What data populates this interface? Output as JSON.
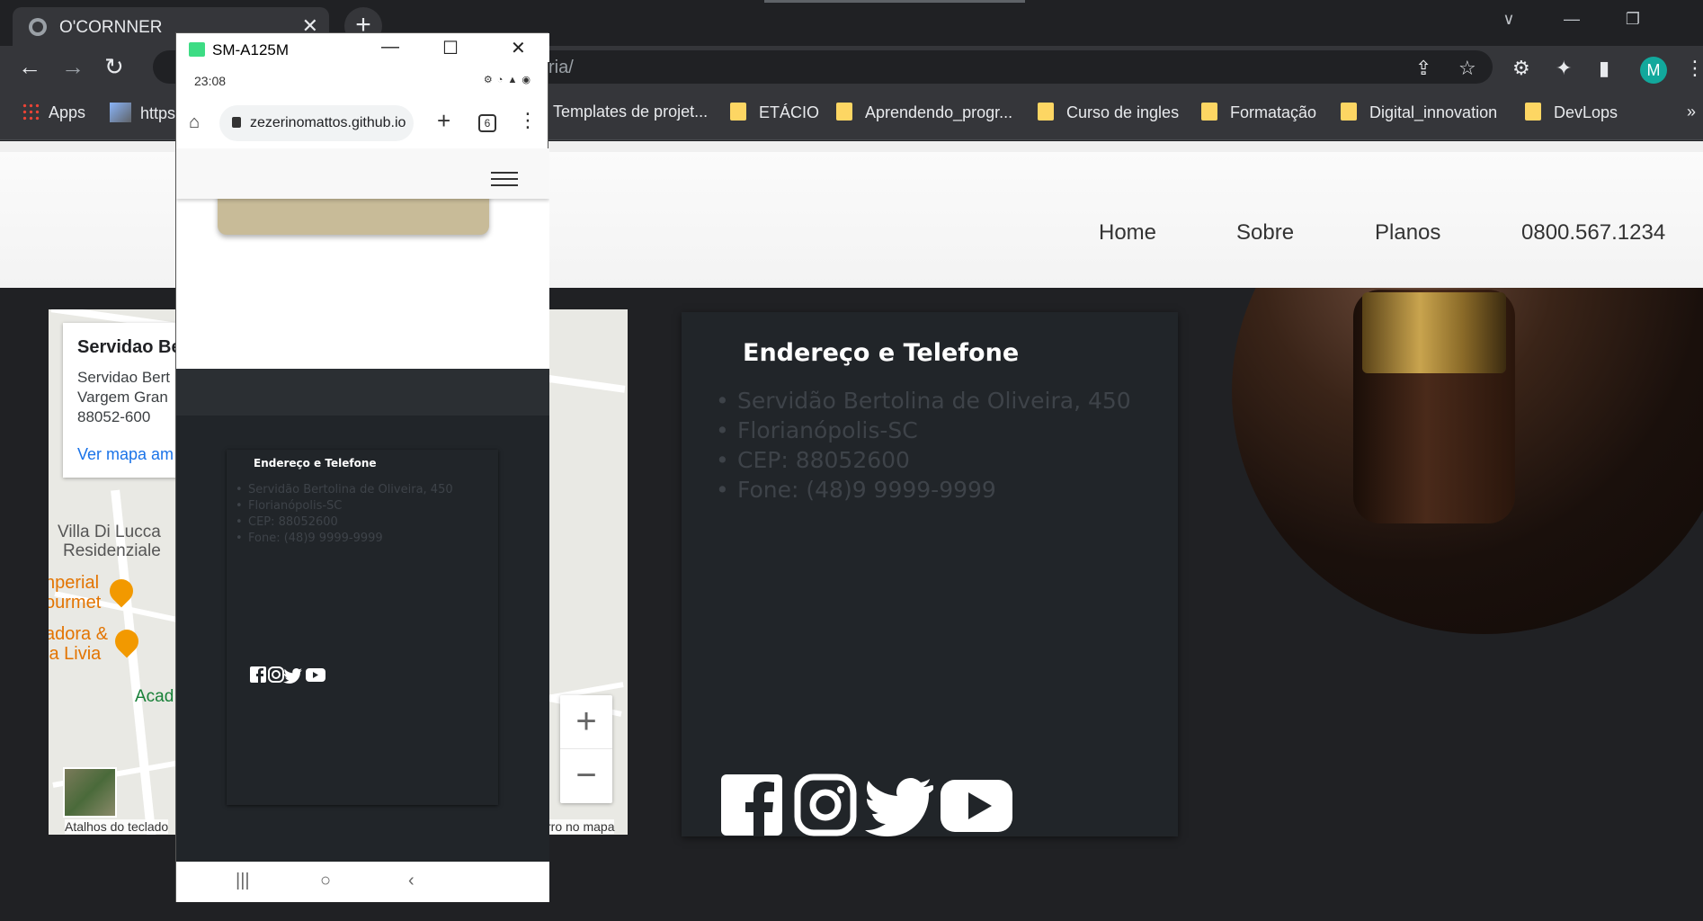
{
  "browser": {
    "tab_title": "O'CORNNER",
    "url_fragment": "ria/",
    "window_controls": [
      "∨",
      "—",
      "❐",
      "✕"
    ],
    "bookmarks": [
      {
        "label": "Apps",
        "type": "apps"
      },
      {
        "label": "https",
        "type": "page"
      },
      {
        "label": "Templates de projet...",
        "type": "folder"
      },
      {
        "label": "ETÁCIO",
        "type": "folder"
      },
      {
        "label": "Aprendendo_progr...",
        "type": "folder"
      },
      {
        "label": "Curso de ingles",
        "type": "folder"
      },
      {
        "label": "Formatação",
        "type": "folder"
      },
      {
        "label": "Digital_innovation",
        "type": "folder"
      },
      {
        "label": "DevLops",
        "type": "folder"
      }
    ],
    "bookmark_overflow": "»",
    "profile_initial": "M"
  },
  "site": {
    "nav": [
      "Home",
      "Sobre",
      "Planos",
      "0800.567.1234"
    ],
    "map": {
      "place_name": "Servidao Be",
      "address_lines": [
        "Servidao Bert",
        "Vargem Gran",
        "88052-600"
      ],
      "link": "Ver mapa am",
      "labels": [
        "Villa Di Lucca",
        "Residenziale",
        "Acad"
      ],
      "poi": [
        "nperial",
        "ourmet",
        "adora &",
        "ia Livia"
      ],
      "footer_left": "Atalhos do teclado",
      "footer_right": "rro no mapa"
    },
    "contact": {
      "heading": "Endereço e Telefone",
      "items": [
        "Servidão Bertolina de Oliveira, 450",
        "Florianópolis-SC",
        "CEP: 88052600",
        "Fone: (48)9 9999-9999"
      ]
    }
  },
  "phone": {
    "window_title": "SM-A125M",
    "time": "23:08",
    "status_icons": "⚙ ◔ ▲ ◉",
    "url": "zezerinomattos.github.io",
    "tab_count": "6",
    "contact_heading": "Endereço e Telefone",
    "contact_items": [
      "Servidão Bertolina de Oliveira, 450",
      "Florianópolis-SC",
      "CEP: 88052600",
      "Fone: (48)9 9999-9999"
    ]
  }
}
